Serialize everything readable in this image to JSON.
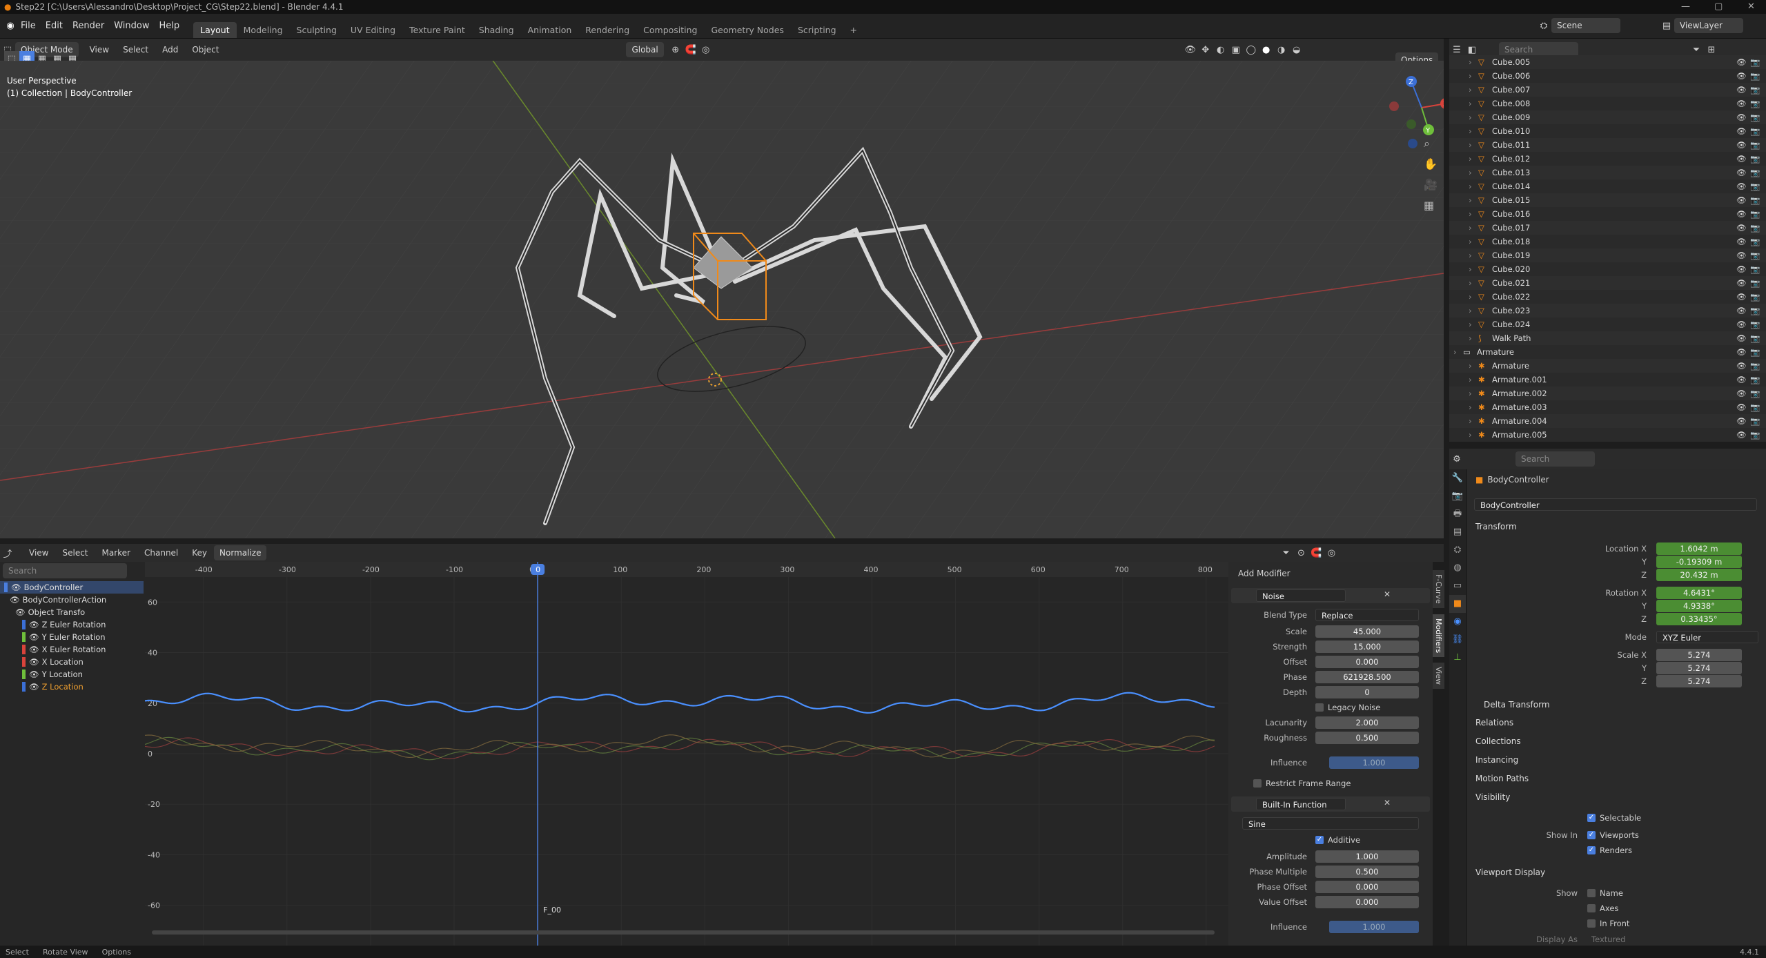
{
  "app": {
    "title": "Step22 [C:\\Users\\Alessandro\\Desktop\\Project_CG\\Step22.blend] - Blender 4.4.1",
    "version": "4.4.1"
  },
  "menu": [
    "File",
    "Edit",
    "Render",
    "Window",
    "Help"
  ],
  "workspaces": [
    "Layout",
    "Modeling",
    "Sculpting",
    "UV Editing",
    "Texture Paint",
    "Shading",
    "Animation",
    "Rendering",
    "Compositing",
    "Geometry Nodes",
    "Scripting"
  ],
  "scene": {
    "scene_label": "Scene",
    "viewlayer_label": "ViewLayer"
  },
  "viewport": {
    "mode": "Object Mode",
    "menus": [
      "View",
      "Select",
      "Add",
      "Object"
    ],
    "orientation": "Global",
    "options": "Options",
    "perspective": "User Perspective",
    "collection": "(1) Collection | BodyController",
    "gizmo_labels": [
      "X",
      "Y",
      "Z"
    ]
  },
  "outliner": {
    "search_placeholder": "Search",
    "items": [
      {
        "name": "Cube.005",
        "kind": "mesh",
        "indent": 1
      },
      {
        "name": "Cube.006",
        "kind": "mesh",
        "indent": 1
      },
      {
        "name": "Cube.007",
        "kind": "mesh",
        "indent": 1
      },
      {
        "name": "Cube.008",
        "kind": "mesh",
        "indent": 1
      },
      {
        "name": "Cube.009",
        "kind": "mesh",
        "indent": 1
      },
      {
        "name": "Cube.010",
        "kind": "mesh",
        "indent": 1
      },
      {
        "name": "Cube.011",
        "kind": "mesh",
        "indent": 1
      },
      {
        "name": "Cube.012",
        "kind": "mesh",
        "indent": 1
      },
      {
        "name": "Cube.013",
        "kind": "mesh",
        "indent": 1
      },
      {
        "name": "Cube.014",
        "kind": "mesh",
        "indent": 1
      },
      {
        "name": "Cube.015",
        "kind": "mesh",
        "indent": 1
      },
      {
        "name": "Cube.016",
        "kind": "mesh",
        "indent": 1
      },
      {
        "name": "Cube.017",
        "kind": "mesh",
        "indent": 1
      },
      {
        "name": "Cube.018",
        "kind": "mesh",
        "indent": 1
      },
      {
        "name": "Cube.019",
        "kind": "mesh",
        "indent": 1
      },
      {
        "name": "Cube.020",
        "kind": "mesh",
        "indent": 1
      },
      {
        "name": "Cube.021",
        "kind": "mesh",
        "indent": 1
      },
      {
        "name": "Cube.022",
        "kind": "mesh",
        "indent": 1
      },
      {
        "name": "Cube.023",
        "kind": "mesh",
        "indent": 1
      },
      {
        "name": "Cube.024",
        "kind": "mesh",
        "indent": 1
      },
      {
        "name": "Walk Path",
        "kind": "curve",
        "indent": 1
      },
      {
        "name": "Armature",
        "kind": "collection",
        "indent": 0
      },
      {
        "name": "Armature",
        "kind": "armature",
        "indent": 1
      },
      {
        "name": "Armature.001",
        "kind": "armature",
        "indent": 1
      },
      {
        "name": "Armature.002",
        "kind": "armature",
        "indent": 1
      },
      {
        "name": "Armature.003",
        "kind": "armature",
        "indent": 1
      },
      {
        "name": "Armature.004",
        "kind": "armature",
        "indent": 1
      },
      {
        "name": "Armature.005",
        "kind": "armature",
        "indent": 1
      }
    ]
  },
  "properties": {
    "search_placeholder": "Search",
    "object_name": "BodyController",
    "datablock": "BodyController",
    "transform_label": "Transform",
    "location": {
      "label": "Location X",
      "x": "1.6042 m",
      "y": "-0.19309 m",
      "z": "20.432 m"
    },
    "rotation": {
      "label": "Rotation X",
      "x": "4.6431°",
      "y": "4.9338°",
      "z": "0.33435°"
    },
    "mode": {
      "label": "Mode",
      "value": "XYZ Euler"
    },
    "scale": {
      "label": "Scale X",
      "x": "5.274",
      "y": "5.274",
      "z": "5.274"
    },
    "axis_y": "Y",
    "axis_z": "Z",
    "sections": [
      "Delta Transform",
      "Relations",
      "Collections",
      "Instancing",
      "Motion Paths"
    ],
    "visibility": {
      "label": "Visibility",
      "selectable": "Selectable",
      "show_in": "Show In",
      "viewports": "Viewports",
      "renders": "Renders"
    },
    "viewport_display": {
      "label": "Viewport Display",
      "show": "Show",
      "name": "Name",
      "axes": "Axes",
      "in_front": "In Front",
      "display_as": "Display As",
      "display_value": "Textured"
    }
  },
  "graph_editor": {
    "menus": [
      "View",
      "Select",
      "Marker",
      "Channel",
      "Key"
    ],
    "normalize": "Normalize",
    "search_placeholder": "Search",
    "frame_marker": "F_00",
    "channels": [
      {
        "name": "BodyController",
        "color": "#4a7fe0"
      },
      {
        "name": "BodyControllerAction",
        "color": ""
      },
      {
        "name": "Object Transfo",
        "color": ""
      },
      {
        "name": "Z Euler Rotation",
        "color": "#3b6fd6"
      },
      {
        "name": "Y Euler Rotation",
        "color": "#6fbf3b"
      },
      {
        "name": "X Euler Rotation",
        "color": "#d9433b"
      },
      {
        "name": "X Location",
        "color": "#d9433b"
      },
      {
        "name": "Y Location",
        "color": "#6fbf3b"
      },
      {
        "name": "Z Location",
        "color": "#3b6fd6"
      }
    ],
    "current_frame": "0"
  },
  "chart_data": {
    "type": "line",
    "x_ticks": [
      "-400",
      "-300",
      "-200",
      "-100",
      "0",
      "100",
      "200",
      "300",
      "400",
      "500",
      "600",
      "700",
      "800"
    ],
    "y_ticks": [
      "60",
      "40",
      "20",
      "0",
      "-20",
      "-40",
      "-60"
    ],
    "xlim": [
      -470,
      810
    ],
    "ylim": [
      -65,
      65
    ],
    "series": [
      {
        "name": "Z Location",
        "color": "#4a90ff",
        "base": 20,
        "amp": 3,
        "style": "noise"
      },
      {
        "name": "X Location",
        "color": "#a04040",
        "base": 2,
        "amp": 3,
        "style": "faint"
      },
      {
        "name": "Y Location",
        "color": "#6a8a40",
        "base": 2,
        "amp": 3,
        "style": "faint"
      },
      {
        "name": "X Euler Rotation",
        "color": "#8a7040",
        "base": 3,
        "amp": 3,
        "style": "faint"
      }
    ]
  },
  "modifiers": {
    "add_label": "Add Modifier",
    "noise": {
      "title": "Noise",
      "blend_type_label": "Blend Type",
      "blend_type": "Replace",
      "scale_label": "Scale",
      "scale": "45.000",
      "strength_label": "Strength",
      "strength": "15.000",
      "offset_label": "Offset",
      "offset": "0.000",
      "phase_label": "Phase",
      "phase": "621928.500",
      "depth_label": "Depth",
      "depth": "0",
      "legacy": "Legacy Noise",
      "lacunarity_label": "Lacunarity",
      "lacunarity": "2.000",
      "roughness_label": "Roughness",
      "roughness": "0.500",
      "influence_label": "Influence",
      "influence": "1.000",
      "restrict": "Restrict Frame Range"
    },
    "builtin": {
      "title": "Built-In Function",
      "function": "Sine",
      "additive": "Additive",
      "amplitude_label": "Amplitude",
      "amplitude": "1.000",
      "phase_mult_label": "Phase Multiple",
      "phase_mult": "0.500",
      "phase_offset_label": "Phase Offset",
      "phase_offset": "0.000",
      "value_offset_label": "Value Offset",
      "value_offset": "0.000",
      "influence_label": "Influence",
      "influence": "1.000"
    },
    "side_tabs": [
      "F-Curve",
      "Modifiers",
      "View"
    ]
  },
  "status": {
    "select": "Select",
    "rotate": "Rotate View",
    "options": "Options",
    "version": "4.4.1"
  }
}
